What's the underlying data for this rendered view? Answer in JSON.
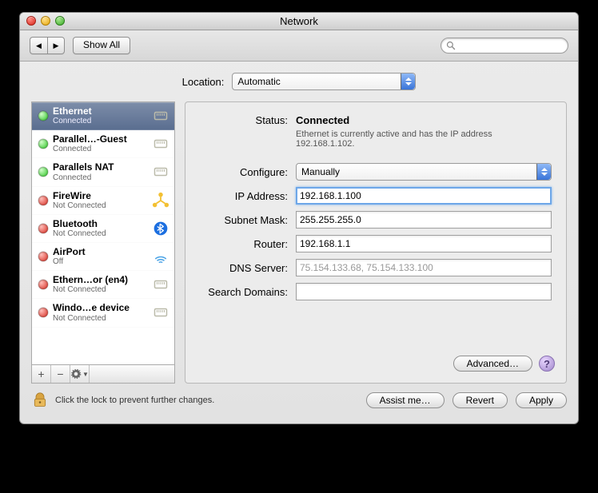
{
  "window": {
    "title": "Network"
  },
  "toolbar": {
    "show_all": "Show All"
  },
  "location": {
    "label": "Location:",
    "value": "Automatic"
  },
  "services": [
    {
      "name": "Ethernet",
      "status": "Connected",
      "dot": "green",
      "icon": "ethernet",
      "selected": true
    },
    {
      "name": "Parallel…-Guest",
      "status": "Connected",
      "dot": "green",
      "icon": "ethernet"
    },
    {
      "name": "Parallels NAT",
      "status": "Connected",
      "dot": "green",
      "icon": "ethernet"
    },
    {
      "name": "FireWire",
      "status": "Not Connected",
      "dot": "redp",
      "icon": "firewire"
    },
    {
      "name": "Bluetooth",
      "status": "Not Connected",
      "dot": "redp",
      "icon": "bluetooth"
    },
    {
      "name": "AirPort",
      "status": "Off",
      "dot": "redp",
      "icon": "airport"
    },
    {
      "name": "Ethern…or (en4)",
      "status": "Not Connected",
      "dot": "redp",
      "icon": "ethernet"
    },
    {
      "name": "Windo…e device",
      "status": "Not Connected",
      "dot": "redp",
      "icon": "ethernet"
    }
  ],
  "detail": {
    "status_label": "Status:",
    "status_value": "Connected",
    "status_desc": "Ethernet is currently active and has the IP address 192.168.1.102.",
    "configure_label": "Configure:",
    "configure_value": "Manually",
    "ip_label": "IP Address:",
    "ip_value": "192.168.1.100",
    "mask_label": "Subnet Mask:",
    "mask_value": "255.255.255.0",
    "router_label": "Router:",
    "router_value": "192.168.1.1",
    "dns_label": "DNS Server:",
    "dns_value": "75.154.133.68, 75.154.133.100",
    "search_label": "Search Domains:",
    "search_value": "",
    "advanced": "Advanced…"
  },
  "footer": {
    "lock_hint": "Click the lock to prevent further changes.",
    "assist": "Assist me…",
    "revert": "Revert",
    "apply": "Apply"
  }
}
